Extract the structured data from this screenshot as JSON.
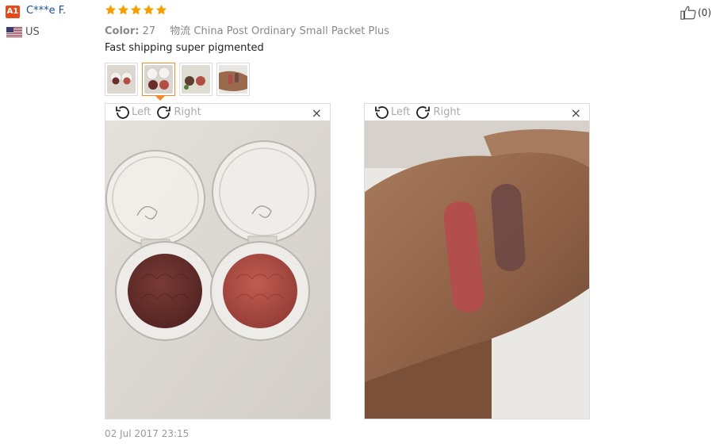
{
  "reviewer": {
    "badge": "A1",
    "name": "C***e F.",
    "flag_icon": "us-flag-icon",
    "country": "US"
  },
  "rating": {
    "stars": 5,
    "max": 5,
    "color": "#f4a000"
  },
  "likes": {
    "icon": "thumbs-up-icon",
    "count": "(0)"
  },
  "order_meta": {
    "color_label": "Color:",
    "color_value": "27",
    "shipping": "物流 China Post Ordinary Small Packet Plus"
  },
  "review_text": "Fast shipping super pigmented",
  "thumbnails": [
    {
      "name": "two-blush-compacts-closed",
      "selected": false
    },
    {
      "name": "two-blush-compacts-open",
      "selected": true
    },
    {
      "name": "blush-compacts-top-view",
      "selected": false
    },
    {
      "name": "hand-swatch",
      "selected": false
    }
  ],
  "viewers": [
    {
      "rotate_left": "Left",
      "rotate_right": "Right",
      "close": "×",
      "image": "two open blush compacts, plum and coral shades"
    },
    {
      "rotate_left": "Left",
      "rotate_right": "Right",
      "close": "×",
      "image": "hand with two blush swatches"
    }
  ],
  "review_date": "02 Jul 2017 23:15",
  "colors": {
    "accent": "#f08a2c",
    "link": "#1a4fa3",
    "badge": "#e64a19"
  }
}
